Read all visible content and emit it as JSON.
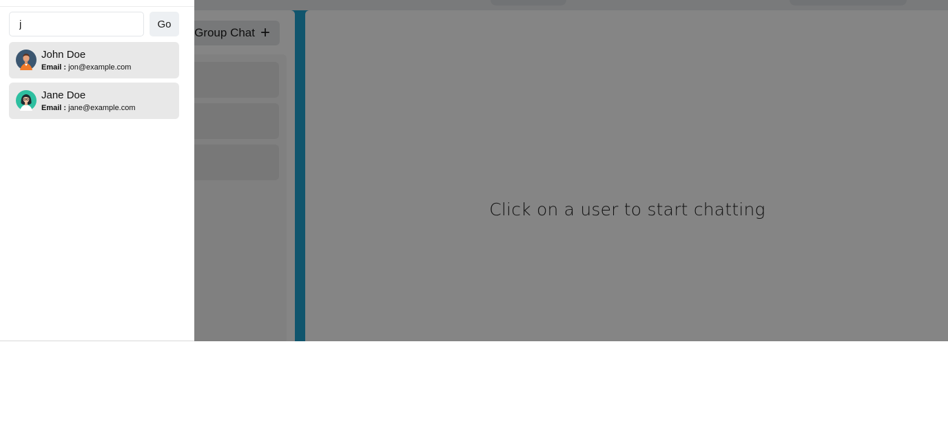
{
  "search": {
    "value": "j"
  },
  "go_button": {
    "label": "Go"
  },
  "results": [
    {
      "name": "John Doe",
      "email_label": "Email :",
      "email": "jon@example.com",
      "avatar": "man-avatar-icon"
    },
    {
      "name": "Jane Doe",
      "email_label": "Email :",
      "email": "jane@example.com",
      "avatar": "woman-avatar-icon"
    }
  ],
  "background": {
    "group_chat_button": {
      "label": "Group Chat",
      "icon": "plus-icon"
    },
    "empty_state": "Click on a user to start chatting"
  },
  "colors": {
    "accent": "#1fa3d2",
    "card": "#e8e8e8",
    "overlay": "rgba(0,0,0,0.48)"
  }
}
